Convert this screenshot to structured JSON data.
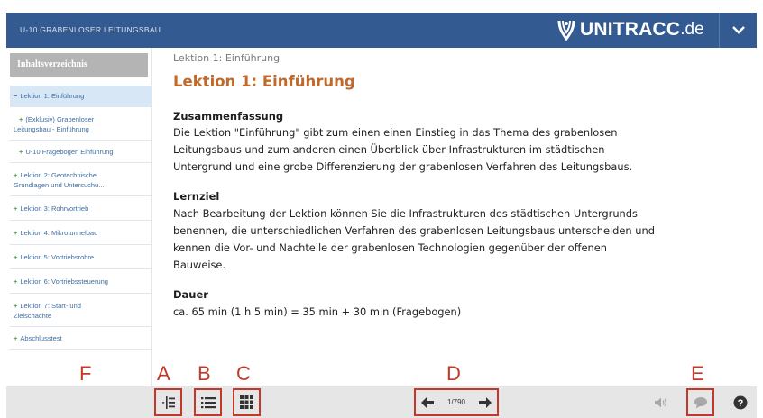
{
  "header": {
    "course_title": "U-10 GRABENLOSER LEITUNGSBAU",
    "logo_text": "UNITRACC",
    "logo_tld": ".de",
    "bg_color": "#335a91"
  },
  "sidebar": {
    "heading": "Inhaltsverzeichnis",
    "items": [
      {
        "marker": "−",
        "lines": [
          "Lektion 1: Einführung"
        ],
        "active": true
      },
      {
        "marker": "+",
        "lines": [
          "(Exklusiv) Grabenloser",
          "Leitungsbau - Einführung"
        ]
      },
      {
        "marker": "+",
        "lines": [
          "U-10 Fragebogen Einführung"
        ]
      },
      {
        "marker": "+",
        "lines": [
          "Lektion 2: Geotechnische",
          "Grundlagen und Untersuchu..."
        ]
      },
      {
        "marker": "+",
        "lines": [
          "Lektion 3: Rohrvortrieb"
        ]
      },
      {
        "marker": "+",
        "lines": [
          "Lektion 4: Mikrotunnelbau"
        ]
      },
      {
        "marker": "+",
        "lines": [
          "Lektion 5: Vortriebsrohre"
        ]
      },
      {
        "marker": "+",
        "lines": [
          "Lektion 6: Vortriebssteuerung"
        ]
      },
      {
        "marker": "+",
        "lines": [
          "Lektion 7: Start- und",
          "Zielschächte"
        ]
      },
      {
        "marker": "+",
        "lines": [
          "Abschlusstest"
        ]
      }
    ]
  },
  "content": {
    "breadcrumb": "Lektion 1: Einführung",
    "title": "Lektion 1: Einführung",
    "summary_heading": "Zusammenfassung",
    "summary_lines": [
      "Die Lektion \"Einführung\" gibt zum einen einen Einstieg in das Thema des grabenlosen",
      "Leitungsbaus und zum anderen einen Überblick über Infrastrukturen im städtischen",
      "Untergrund und eine grobe Differenzierung der grabenlosen Verfahren des Leitungsbaus."
    ],
    "goal_heading": "Lernziel",
    "goal_lines": [
      "Nach Bearbeitung der Lektion können Sie die Infrastrukturen des städtischen Untergrunds",
      "benennen, die unterschiedlichen Verfahren des grabenlosen Leitungsbaus unterscheiden und",
      "kennen die Vor- und Nachteile der grabenlosen Technologien gegenüber der offenen",
      "Bauweise."
    ],
    "duration_heading": "Dauer",
    "duration_text": "ca. 65 min (1 h 5 min) = 35 min + 30 min (Fragebogen)",
    "title_color": "#c0692a"
  },
  "footer": {
    "page_counter": "1/790",
    "icons": {
      "a": "toc-toggle-icon",
      "b": "list-icon",
      "c": "grid-icon",
      "prev": "arrow-left-icon",
      "next": "arrow-right-icon",
      "audio": "speaker-icon",
      "comment": "speech-bubble-icon",
      "help": "help-icon"
    }
  },
  "annotations": {
    "a": "A",
    "b": "B",
    "c": "C",
    "d": "D",
    "e": "E",
    "f": "F",
    "color": "#c0392b"
  }
}
